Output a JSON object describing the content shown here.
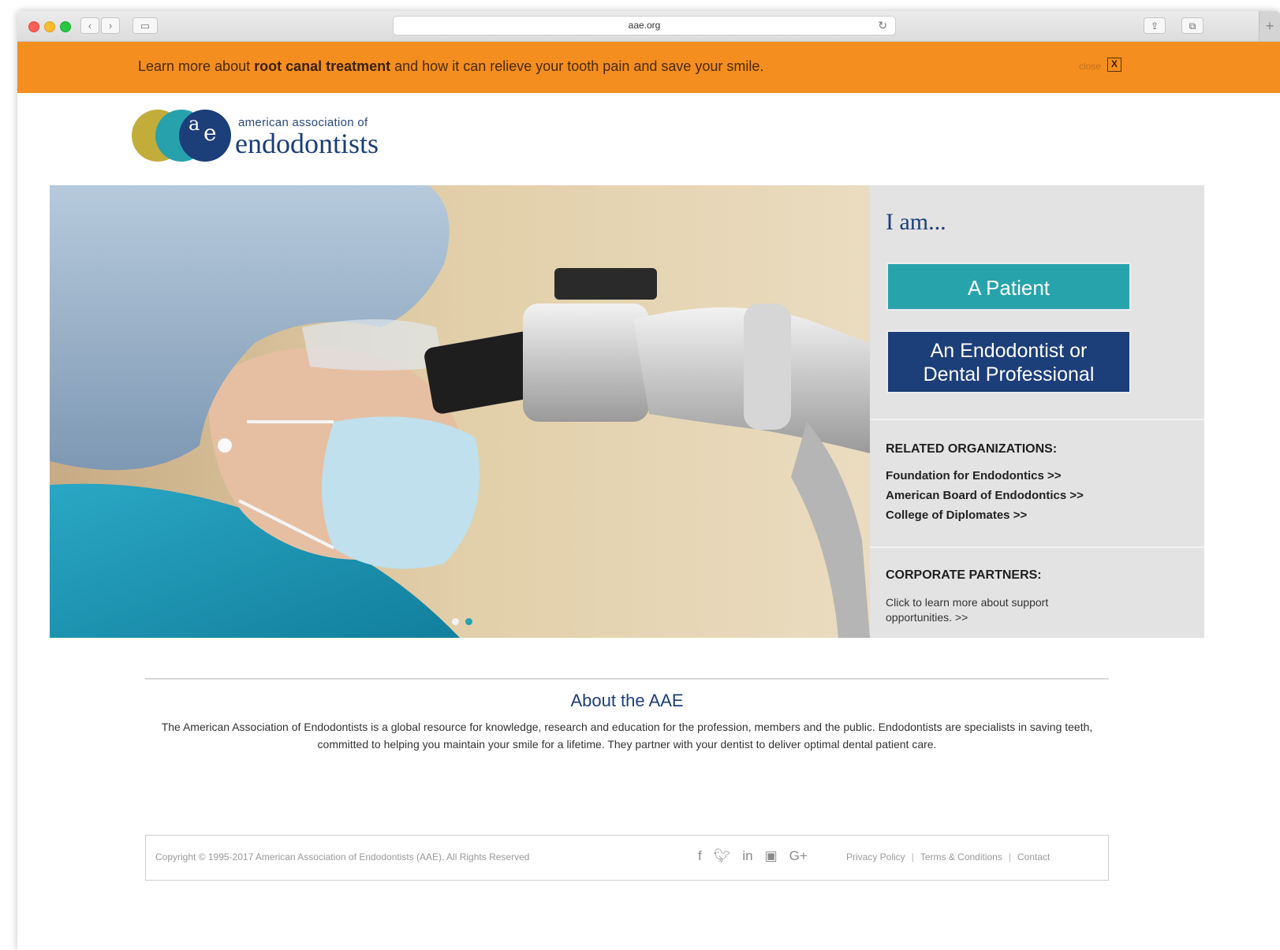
{
  "browser": {
    "url": "aae.org"
  },
  "banner": {
    "text_before": "Learn more about ",
    "text_bold": "root canal treatment",
    "text_after": " and how it can relieve your tooth pain and save your smile.",
    "close_label": "close",
    "close_x": "X"
  },
  "logo": {
    "small_text": "american association of",
    "big_text": "endodontists",
    "mark_a": "a",
    "mark_e": "e"
  },
  "hero": {
    "slides": 2,
    "active_slide": 1
  },
  "side": {
    "iam": "I am...",
    "patient_button": "A Patient",
    "professional_button_line1": "An Endodontist or",
    "professional_button_line2": "Dental Professional",
    "related_title": "RELATED ORGANIZATIONS:",
    "related_links": [
      "Foundation for Endodontics >>",
      "American Board of Endodontics >>",
      "College of Diplomates >>"
    ],
    "corporate_title": "CORPORATE PARTNERS:",
    "corporate_text": "Click to learn more about support opportunities. >>"
  },
  "about": {
    "title": "About the AAE",
    "text": "The American Association of Endodontists is a global resource for knowledge, research and education for the profession, members and the public. Endodontists are specialists in saving teeth, committed to helping you maintain your smile for a lifetime. They partner with your dentist to deliver optimal dental patient care."
  },
  "footer": {
    "copyright": "Copyright © 1995-2017 American Association of Endodontists (AAE). All Rights Reserved",
    "social_icons": [
      "facebook-icon",
      "twitter-icon",
      "linkedin-icon",
      "youtube-icon",
      "google-plus-icon"
    ],
    "links": [
      "Privacy Policy",
      "Terms & Conditions",
      "Contact"
    ]
  },
  "colors": {
    "banner": "#f48e1f",
    "navy": "#1c3e79",
    "teal": "#27a3ac",
    "gold": "#c2ad3b"
  }
}
